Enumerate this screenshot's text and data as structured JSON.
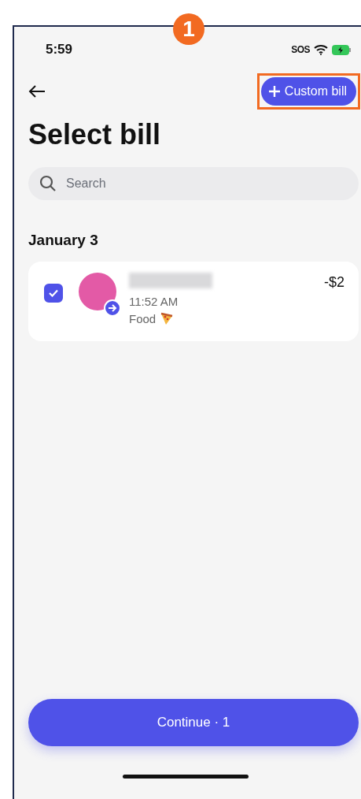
{
  "annotation": {
    "step": "1"
  },
  "status_bar": {
    "time": "5:59",
    "sos": "SOS"
  },
  "header": {
    "custom_bill_button": "Custom bill",
    "highlighted": true
  },
  "title": "Select bill",
  "search": {
    "placeholder": "Search"
  },
  "groups": [
    {
      "date": "January 3",
      "bills": [
        {
          "checked": true,
          "time": "11:52 AM",
          "category": "Food",
          "amount": "-$2"
        }
      ]
    }
  ],
  "continue_button": "Continue · 1"
}
